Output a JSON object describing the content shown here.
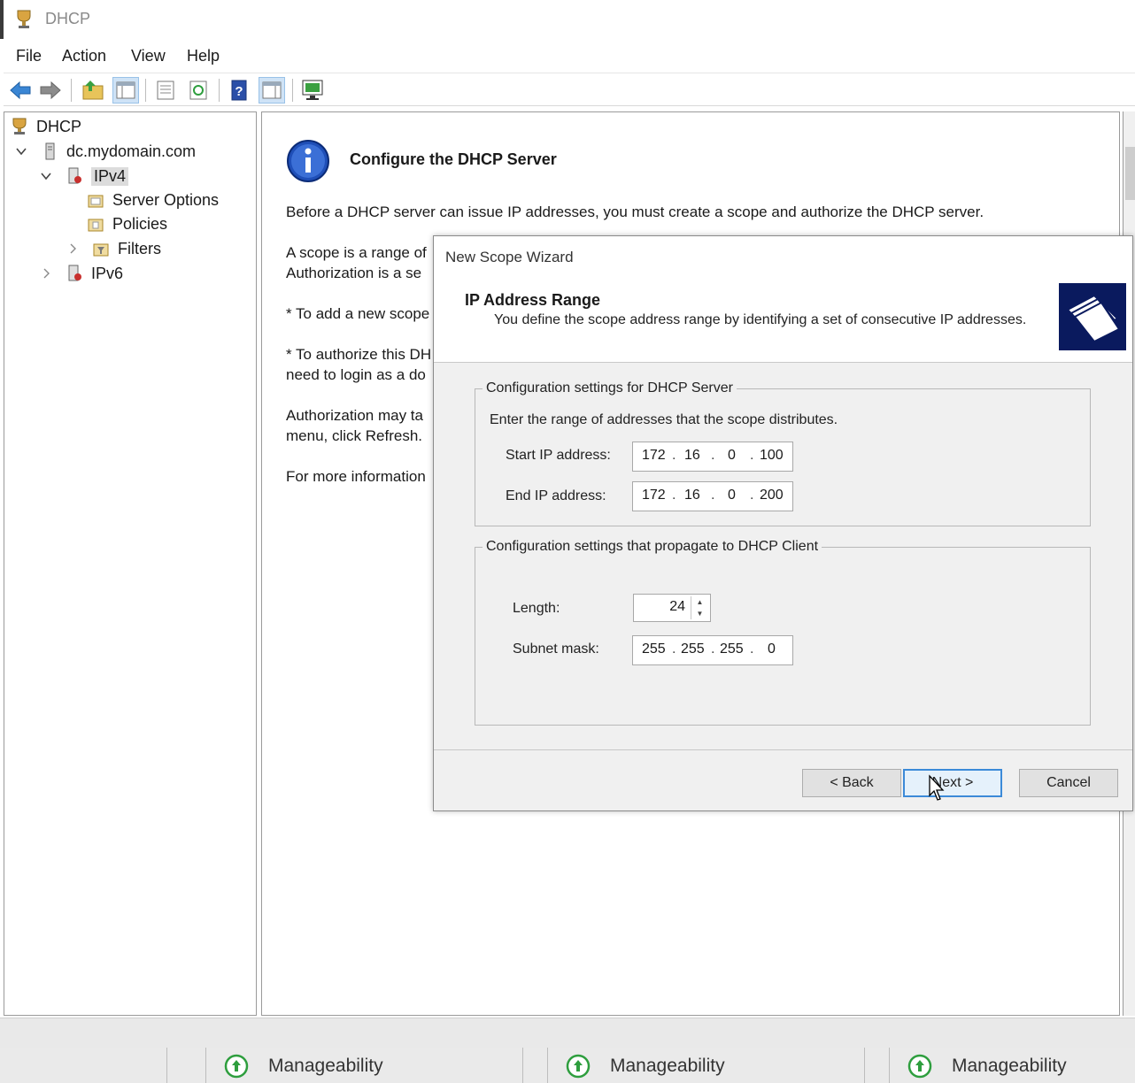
{
  "window": {
    "title": "DHCP"
  },
  "menu": {
    "file": "File",
    "action": "Action",
    "view": "View",
    "help": "Help"
  },
  "toolbar": {
    "icons": [
      "back-arrow-icon",
      "forward-arrow-icon",
      "folder-up-icon",
      "show-hide-console-tree-icon",
      "properties-icon",
      "refresh-icon",
      "help-icon",
      "show-hide-action-pane-icon",
      "console-monitor-icon"
    ]
  },
  "tree": {
    "root": "DHCP",
    "server": "dc.mydomain.com",
    "ipv4": "IPv4",
    "server_options": "Server Options",
    "policies": "Policies",
    "filters": "Filters",
    "ipv6": "IPv6"
  },
  "content": {
    "title": "Configure the DHCP Server",
    "line1": "Before a DHCP server can issue IP addresses, you must create a scope and authorize the DHCP server.",
    "line2a": "A scope is a range of",
    "line2b": "Authorization is a se",
    "line3": "* To add a new scope",
    "line4a": "* To authorize this DH",
    "line4b": "need to login as a do",
    "line5a": "Authorization may ta",
    "line5b": "menu, click Refresh.",
    "line6": "For more information"
  },
  "wizard": {
    "caption": "New Scope Wizard",
    "step_title": "IP Address Range",
    "step_desc": "You define the scope address range by identifying a set of consecutive IP addresses.",
    "group1": {
      "legend": "Configuration settings for DHCP Server",
      "instruction": "Enter the range of addresses that the scope distributes.",
      "start_label": "Start IP address:",
      "start_ip": [
        "172",
        "16",
        "0",
        "100"
      ],
      "end_label": "End IP address:",
      "end_ip": [
        "172",
        "16",
        "0",
        "200"
      ]
    },
    "group2": {
      "legend": "Configuration settings that propagate to DHCP Client",
      "length_label": "Length:",
      "length_value": "24",
      "mask_label": "Subnet mask:",
      "mask": [
        "255",
        "255",
        "255",
        "0"
      ]
    },
    "buttons": {
      "back": "< Back",
      "next": "Next >",
      "cancel": "Cancel"
    }
  },
  "taskbar": {
    "tiles": [
      "Manageability",
      "Manageability",
      "Manageability"
    ],
    "status_color": "#2e9e3e"
  }
}
